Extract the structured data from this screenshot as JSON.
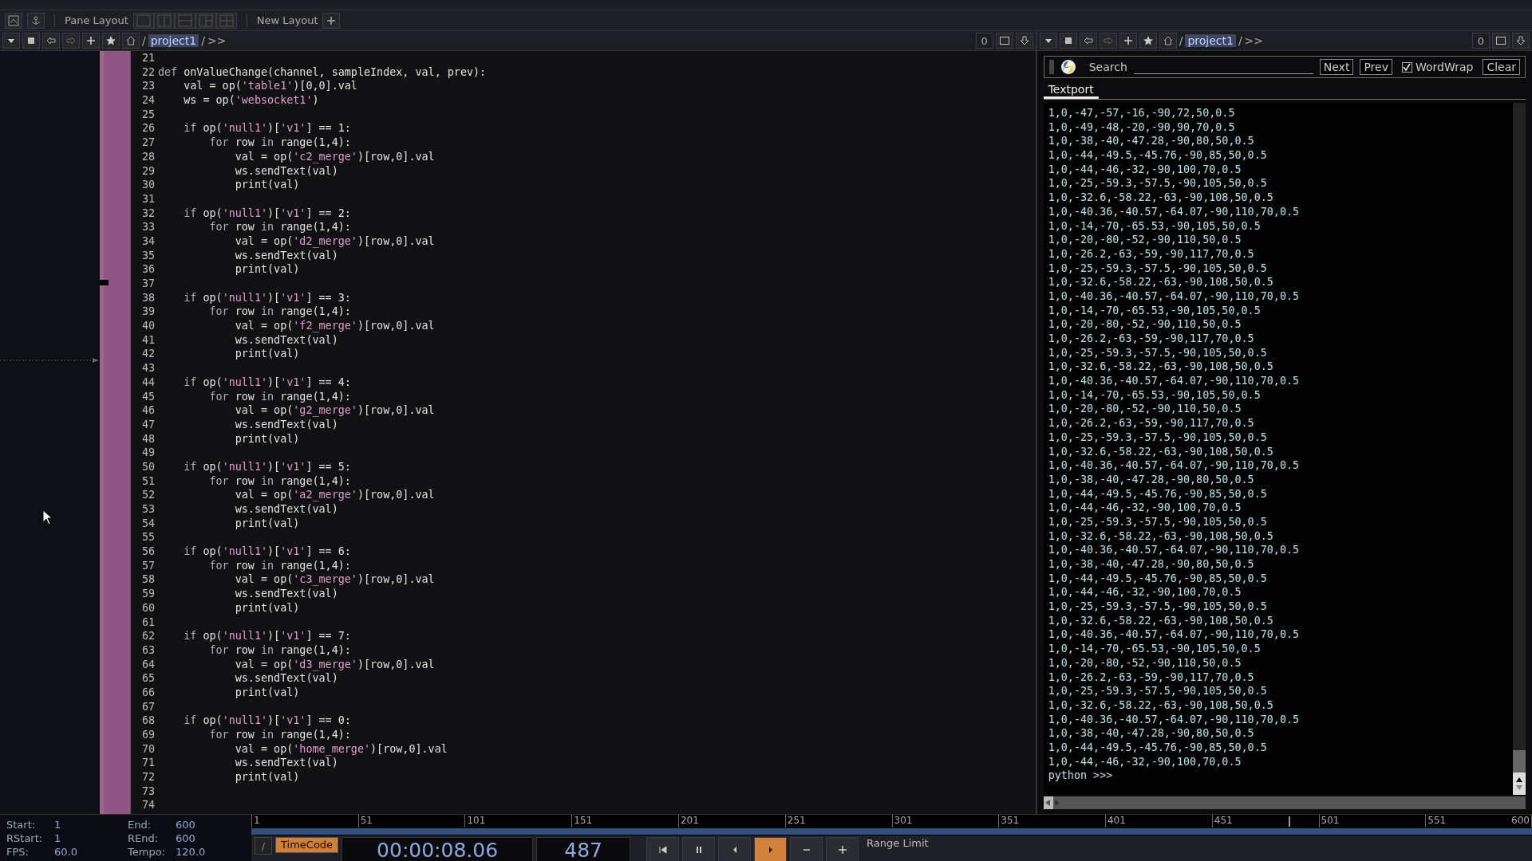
{
  "toolbar": {
    "label": "Pane Layout",
    "layouts": [
      {
        "kind": "single"
      },
      {
        "kind": "columns"
      },
      {
        "kind": "rows"
      },
      {
        "kind": "grid3"
      },
      {
        "kind": "grid4"
      }
    ],
    "new_layout": "New Layout"
  },
  "path_bars": [
    {
      "root": "/",
      "current": "project1",
      "after": "/",
      "more": ">>",
      "count": "0"
    },
    {
      "root": "/",
      "current": "project1",
      "after": "/",
      "more": ">>",
      "count": "0"
    }
  ],
  "editor": {
    "lines": [
      {
        "number": "21"
      },
      {
        "number": "22",
        "segments": [
          {
            "kind": "keyword",
            "text": "def"
          },
          {
            "kind": "plain",
            "text": " onValueChange(channel, sampleIndex, val, prev):"
          }
        ]
      },
      {
        "number": "23",
        "segments": [
          {
            "kind": "plain",
            "text": "    val = op("
          },
          {
            "kind": "string",
            "text": "'table1'"
          },
          {
            "kind": "plain",
            "text": ")[0,0].val"
          }
        ]
      },
      {
        "number": "24",
        "segments": [
          {
            "kind": "plain",
            "text": "    ws = op("
          },
          {
            "kind": "string",
            "text": "'websocket1'"
          },
          {
            "kind": "plain",
            "text": ")"
          }
        ]
      },
      {
        "number": "25"
      },
      {
        "number": "26",
        "segments": [
          {
            "kind": "keyword",
            "text": "    if"
          },
          {
            "kind": "plain",
            "text": " op("
          },
          {
            "kind": "string",
            "text": "'null1'"
          },
          {
            "kind": "plain",
            "text": ")["
          },
          {
            "kind": "string",
            "text": "'v1'"
          },
          {
            "kind": "plain",
            "text": "] == 1:"
          }
        ]
      },
      {
        "number": "27",
        "segments": [
          {
            "kind": "keyword",
            "text": "        for"
          },
          {
            "kind": "plain",
            "text": " row "
          },
          {
            "kind": "keyword",
            "text": "in"
          },
          {
            "kind": "plain",
            "text": " range(1,4):"
          }
        ]
      },
      {
        "number": "28",
        "segments": [
          {
            "kind": "plain",
            "text": "            val = op("
          },
          {
            "kind": "string",
            "text": "'c2_merge'"
          },
          {
            "kind": "plain",
            "text": ")[row,0].val"
          }
        ]
      },
      {
        "number": "29",
        "segments": [
          {
            "kind": "plain",
            "text": "            ws.sendText(val)"
          }
        ]
      },
      {
        "number": "30",
        "segments": [
          {
            "kind": "plain",
            "text": "            print(val)"
          }
        ]
      },
      {
        "number": "31"
      },
      {
        "number": "32",
        "segments": [
          {
            "kind": "keyword",
            "text": "    if"
          },
          {
            "kind": "plain",
            "text": " op("
          },
          {
            "kind": "string",
            "text": "'null1'"
          },
          {
            "kind": "plain",
            "text": ")["
          },
          {
            "kind": "string",
            "text": "'v1'"
          },
          {
            "kind": "plain",
            "text": "] == 2:"
          }
        ]
      },
      {
        "number": "33",
        "segments": [
          {
            "kind": "keyword",
            "text": "        for"
          },
          {
            "kind": "plain",
            "text": " row "
          },
          {
            "kind": "keyword",
            "text": "in"
          },
          {
            "kind": "plain",
            "text": " range(1,4):"
          }
        ]
      },
      {
        "number": "34",
        "segments": [
          {
            "kind": "plain",
            "text": "            val = op("
          },
          {
            "kind": "string",
            "text": "'d2_merge'"
          },
          {
            "kind": "plain",
            "text": ")[row,0].val"
          }
        ]
      },
      {
        "number": "35",
        "segments": [
          {
            "kind": "plain",
            "text": "            ws.sendText(val)"
          }
        ]
      },
      {
        "number": "36",
        "segments": [
          {
            "kind": "plain",
            "text": "            print(val)"
          }
        ]
      },
      {
        "number": "37"
      },
      {
        "number": "38",
        "segments": [
          {
            "kind": "keyword",
            "text": "    if"
          },
          {
            "kind": "plain",
            "text": " op("
          },
          {
            "kind": "string",
            "text": "'null1'"
          },
          {
            "kind": "plain",
            "text": ")["
          },
          {
            "kind": "string",
            "text": "'v1'"
          },
          {
            "kind": "plain",
            "text": "] == 3:"
          }
        ]
      },
      {
        "number": "39",
        "segments": [
          {
            "kind": "keyword",
            "text": "        for"
          },
          {
            "kind": "plain",
            "text": " row "
          },
          {
            "kind": "keyword",
            "text": "in"
          },
          {
            "kind": "plain",
            "text": " range(1,4):"
          }
        ]
      },
      {
        "number": "40",
        "segments": [
          {
            "kind": "plain",
            "text": "            val = op("
          },
          {
            "kind": "string",
            "text": "'f2_merge'"
          },
          {
            "kind": "plain",
            "text": ")[row,0].val"
          }
        ]
      },
      {
        "number": "41",
        "segments": [
          {
            "kind": "plain",
            "text": "            ws.sendText(val)"
          }
        ]
      },
      {
        "number": "42",
        "segments": [
          {
            "kind": "plain",
            "text": "            print(val)"
          }
        ]
      },
      {
        "number": "43"
      },
      {
        "number": "44",
        "segments": [
          {
            "kind": "keyword",
            "text": "    if"
          },
          {
            "kind": "plain",
            "text": " op("
          },
          {
            "kind": "string",
            "text": "'null1'"
          },
          {
            "kind": "plain",
            "text": ")["
          },
          {
            "kind": "string",
            "text": "'v1'"
          },
          {
            "kind": "plain",
            "text": "] == 4:"
          }
        ]
      },
      {
        "number": "45",
        "segments": [
          {
            "kind": "keyword",
            "text": "        for"
          },
          {
            "kind": "plain",
            "text": " row "
          },
          {
            "kind": "keyword",
            "text": "in"
          },
          {
            "kind": "plain",
            "text": " range(1,4):"
          }
        ]
      },
      {
        "number": "46",
        "segments": [
          {
            "kind": "plain",
            "text": "            val = op("
          },
          {
            "kind": "string",
            "text": "'g2_merge'"
          },
          {
            "kind": "plain",
            "text": ")[row,0].val"
          }
        ]
      },
      {
        "number": "47",
        "segments": [
          {
            "kind": "plain",
            "text": "            ws.sendText(val)"
          }
        ]
      },
      {
        "number": "48",
        "segments": [
          {
            "kind": "plain",
            "text": "            print(val)"
          }
        ]
      },
      {
        "number": "49"
      },
      {
        "number": "50",
        "segments": [
          {
            "kind": "keyword",
            "text": "    if"
          },
          {
            "kind": "plain",
            "text": " op("
          },
          {
            "kind": "string",
            "text": "'null1'"
          },
          {
            "kind": "plain",
            "text": ")["
          },
          {
            "kind": "string",
            "text": "'v1'"
          },
          {
            "kind": "plain",
            "text": "] == 5:"
          }
        ]
      },
      {
        "number": "51",
        "segments": [
          {
            "kind": "keyword",
            "text": "        for"
          },
          {
            "kind": "plain",
            "text": " row "
          },
          {
            "kind": "keyword",
            "text": "in"
          },
          {
            "kind": "plain",
            "text": " range(1,4):"
          }
        ]
      },
      {
        "number": "52",
        "segments": [
          {
            "kind": "plain",
            "text": "            val = op("
          },
          {
            "kind": "string",
            "text": "'a2_merge'"
          },
          {
            "kind": "plain",
            "text": ")[row,0].val"
          }
        ]
      },
      {
        "number": "53",
        "segments": [
          {
            "kind": "plain",
            "text": "            ws.sendText(val)"
          }
        ]
      },
      {
        "number": "54",
        "segments": [
          {
            "kind": "plain",
            "text": "            print(val)"
          }
        ]
      },
      {
        "number": "55"
      },
      {
        "number": "56",
        "segments": [
          {
            "kind": "keyword",
            "text": "    if"
          },
          {
            "kind": "plain",
            "text": " op("
          },
          {
            "kind": "string",
            "text": "'null1'"
          },
          {
            "kind": "plain",
            "text": ")["
          },
          {
            "kind": "string",
            "text": "'v1'"
          },
          {
            "kind": "plain",
            "text": "] == 6:"
          }
        ]
      },
      {
        "number": "57",
        "segments": [
          {
            "kind": "keyword",
            "text": "        for"
          },
          {
            "kind": "plain",
            "text": " row "
          },
          {
            "kind": "keyword",
            "text": "in"
          },
          {
            "kind": "plain",
            "text": " range(1,4):"
          }
        ]
      },
      {
        "number": "58",
        "segments": [
          {
            "kind": "plain",
            "text": "            val = op("
          },
          {
            "kind": "string",
            "text": "'c3_merge'"
          },
          {
            "kind": "plain",
            "text": ")[row,0].val"
          }
        ]
      },
      {
        "number": "59",
        "segments": [
          {
            "kind": "plain",
            "text": "            ws.sendText(val)"
          }
        ]
      },
      {
        "number": "60",
        "segments": [
          {
            "kind": "plain",
            "text": "            print(val)"
          }
        ]
      },
      {
        "number": "61"
      },
      {
        "number": "62",
        "segments": [
          {
            "kind": "keyword",
            "text": "    if"
          },
          {
            "kind": "plain",
            "text": " op("
          },
          {
            "kind": "string",
            "text": "'null1'"
          },
          {
            "kind": "plain",
            "text": ")["
          },
          {
            "kind": "string",
            "text": "'v1'"
          },
          {
            "kind": "plain",
            "text": "] == 7:"
          }
        ]
      },
      {
        "number": "63",
        "segments": [
          {
            "kind": "keyword",
            "text": "        for"
          },
          {
            "kind": "plain",
            "text": " row "
          },
          {
            "kind": "keyword",
            "text": "in"
          },
          {
            "kind": "plain",
            "text": " range(1,4):"
          }
        ]
      },
      {
        "number": "64",
        "segments": [
          {
            "kind": "plain",
            "text": "            val = op("
          },
          {
            "kind": "string",
            "text": "'d3_merge'"
          },
          {
            "kind": "plain",
            "text": ")[row,0].val"
          }
        ]
      },
      {
        "number": "65",
        "segments": [
          {
            "kind": "plain",
            "text": "            ws.sendText(val)"
          }
        ]
      },
      {
        "number": "66",
        "segments": [
          {
            "kind": "plain",
            "text": "            print(val)"
          }
        ]
      },
      {
        "number": "67"
      },
      {
        "number": "68",
        "segments": [
          {
            "kind": "keyword",
            "text": "    if"
          },
          {
            "kind": "plain",
            "text": " op("
          },
          {
            "kind": "string",
            "text": "'null1'"
          },
          {
            "kind": "plain",
            "text": ")["
          },
          {
            "kind": "string",
            "text": "'v1'"
          },
          {
            "kind": "plain",
            "text": "] == 0:"
          }
        ]
      },
      {
        "number": "69",
        "segments": [
          {
            "kind": "keyword",
            "text": "        for"
          },
          {
            "kind": "plain",
            "text": " row "
          },
          {
            "kind": "keyword",
            "text": "in"
          },
          {
            "kind": "plain",
            "text": " range(1,4):"
          }
        ]
      },
      {
        "number": "70",
        "segments": [
          {
            "kind": "plain",
            "text": "            val = op("
          },
          {
            "kind": "string",
            "text": "'home_merge'"
          },
          {
            "kind": "plain",
            "text": ")[row,0].val"
          }
        ]
      },
      {
        "number": "71",
        "segments": [
          {
            "kind": "plain",
            "text": "            ws.sendText(val)"
          }
        ]
      },
      {
        "number": "72",
        "segments": [
          {
            "kind": "plain",
            "text": "            print(val)"
          }
        ]
      },
      {
        "number": "73"
      },
      {
        "number": "74"
      }
    ]
  },
  "textport": {
    "search_label": "Search",
    "next": "Next",
    "prev": "Prev",
    "wordwrap": {
      "label": "WordWrap",
      "checked": true
    },
    "clear": "Clear",
    "tabs": [
      {
        "label": "Textport",
        "selected": true
      }
    ],
    "lines": [
      "1,0,-47,-57,-16,-90,72,50,0.5",
      "1,0,-49,-48,-20,-90,90,70,0.5",
      "1,0,-38,-40,-47.28,-90,80,50,0.5",
      "1,0,-44,-49.5,-45.76,-90,85,50,0.5",
      "1,0,-44,-46,-32,-90,100,70,0.5",
      "1,0,-25,-59.3,-57.5,-90,105,50,0.5",
      "1,0,-32.6,-58.22,-63,-90,108,50,0.5",
      "1,0,-40.36,-40.57,-64.07,-90,110,70,0.5",
      "1,0,-14,-70,-65.53,-90,105,50,0.5",
      "1,0,-20,-80,-52,-90,110,50,0.5",
      "1,0,-26.2,-63,-59,-90,117,70,0.5",
      "1,0,-25,-59.3,-57.5,-90,105,50,0.5",
      "1,0,-32.6,-58.22,-63,-90,108,50,0.5",
      "1,0,-40.36,-40.57,-64.07,-90,110,70,0.5",
      "1,0,-14,-70,-65.53,-90,105,50,0.5",
      "1,0,-20,-80,-52,-90,110,50,0.5",
      "1,0,-26.2,-63,-59,-90,117,70,0.5",
      "1,0,-25,-59.3,-57.5,-90,105,50,0.5",
      "1,0,-32.6,-58.22,-63,-90,108,50,0.5",
      "1,0,-40.36,-40.57,-64.07,-90,110,70,0.5",
      "1,0,-14,-70,-65.53,-90,105,50,0.5",
      "1,0,-20,-80,-52,-90,110,50,0.5",
      "1,0,-26.2,-63,-59,-90,117,70,0.5",
      "1,0,-25,-59.3,-57.5,-90,105,50,0.5",
      "1,0,-32.6,-58.22,-63,-90,108,50,0.5",
      "1,0,-40.36,-40.57,-64.07,-90,110,70,0.5",
      "1,0,-38,-40,-47.28,-90,80,50,0.5",
      "1,0,-44,-49.5,-45.76,-90,85,50,0.5",
      "1,0,-44,-46,-32,-90,100,70,0.5",
      "1,0,-25,-59.3,-57.5,-90,105,50,0.5",
      "1,0,-32.6,-58.22,-63,-90,108,50,0.5",
      "1,0,-40.36,-40.57,-64.07,-90,110,70,0.5",
      "1,0,-38,-40,-47.28,-90,80,50,0.5",
      "1,0,-44,-49.5,-45.76,-90,85,50,0.5",
      "1,0,-44,-46,-32,-90,100,70,0.5",
      "1,0,-25,-59.3,-57.5,-90,105,50,0.5",
      "1,0,-32.6,-58.22,-63,-90,108,50,0.5",
      "1,0,-40.36,-40.57,-64.07,-90,110,70,0.5",
      "1,0,-14,-70,-65.53,-90,105,50,0.5",
      "1,0,-20,-80,-52,-90,110,50,0.5",
      "1,0,-26.2,-63,-59,-90,117,70,0.5",
      "1,0,-25,-59.3,-57.5,-90,105,50,0.5",
      "1,0,-32.6,-58.22,-63,-90,108,50,0.5",
      "1,0,-40.36,-40.57,-64.07,-90,110,70,0.5",
      "1,0,-38,-40,-47.28,-90,80,50,0.5",
      "1,0,-44,-49.5,-45.76,-90,85,50,0.5",
      "1,0,-44,-46,-32,-90,100,70,0.5"
    ],
    "prompt": "python >>>"
  },
  "timeline": {
    "info": [
      {
        "label": "Start:",
        "value": "1"
      },
      {
        "label": "End:",
        "value": "600"
      },
      {
        "label": "RStart:",
        "value": "1"
      },
      {
        "label": "REnd:",
        "value": "600"
      },
      {
        "label": "FPS:",
        "value": "60.0"
      },
      {
        "label": "Tempo:",
        "value": "120.0"
      }
    ],
    "ticks": [
      "1",
      "51",
      "101",
      "151",
      "201",
      "251",
      "301",
      "351",
      "401",
      "451",
      "501",
      "551",
      "600"
    ],
    "playhead": {
      "level": 0.81
    },
    "mode_button": "/",
    "timecode_button": {
      "label": "TimeCode",
      "selected": true
    },
    "timecode": "00:00:08.06",
    "frame": "487",
    "transport": [
      {
        "kind": "first",
        "selected": false
      },
      {
        "kind": "pause",
        "selected": false
      },
      {
        "kind": "step-back",
        "selected": false
      },
      {
        "kind": "play",
        "selected": true
      },
      {
        "kind": "minus",
        "selected": false
      },
      {
        "kind": "plus",
        "selected": false
      }
    ],
    "range_limit": "Range Limit"
  }
}
